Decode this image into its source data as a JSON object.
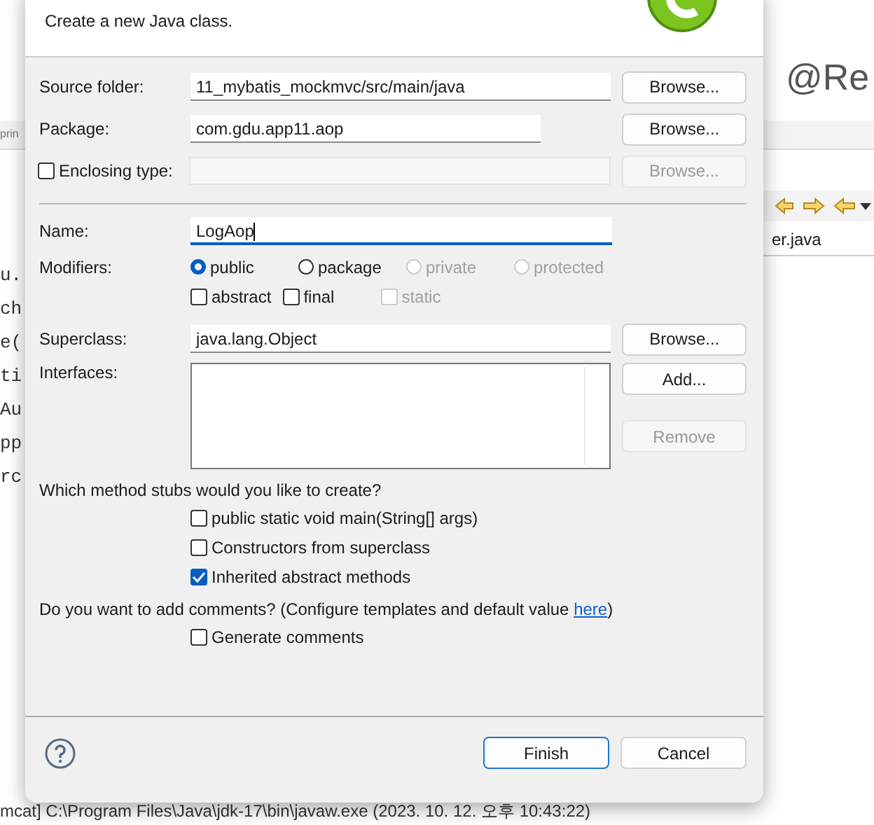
{
  "background": {
    "heading": "@Re",
    "toolbar_text": "prin",
    "editor_tab": "er.java",
    "code_lines": [
      "u.",
      "ch",
      "e(",
      "ti",
      "Au",
      "pp",
      "rc"
    ],
    "console": "mcat] C:\\Program Files\\Java\\jdk-17\\bin\\javaw.exe  (2023. 10. 12. 오후 10:43:22)"
  },
  "dialog": {
    "description": "Create a new Java class.",
    "fields": [
      {
        "kind": "text",
        "label": "Source folder:",
        "value": "11_mybatis_mockmvc/src/main/java",
        "button": "Browse...",
        "button_disabled": false
      },
      {
        "kind": "short",
        "label": "Package:",
        "value": "com.gdu.app11.aop",
        "button": "Browse...",
        "button_disabled": false
      },
      {
        "kind": "check",
        "label": "Enclosing type:",
        "checked": false,
        "button": "Browse...",
        "button_disabled": true
      }
    ],
    "name": {
      "label": "Name:",
      "value": "LogAop"
    },
    "modifiers": {
      "label": "Modifiers:",
      "radios": [
        {
          "label": "public",
          "selected": true,
          "disabled": false
        },
        {
          "label": "package",
          "selected": false,
          "disabled": false
        },
        {
          "label": "private",
          "selected": false,
          "disabled": true
        },
        {
          "label": "protected",
          "selected": false,
          "disabled": true
        }
      ],
      "checks": [
        {
          "label": "abstract",
          "checked": false,
          "disabled": false
        },
        {
          "label": "final",
          "checked": false,
          "disabled": false
        },
        {
          "label": "static",
          "checked": false,
          "disabled": true
        }
      ]
    },
    "superclass": {
      "label": "Superclass:",
      "value": "java.lang.Object",
      "button": "Browse..."
    },
    "interfaces": {
      "label": "Interfaces:",
      "buttons": [
        {
          "label": "Add...",
          "disabled": false
        },
        {
          "label": "Remove",
          "disabled": true
        }
      ]
    },
    "stubs": {
      "question": "Which method stubs would you like to create?",
      "options": [
        {
          "label": "public static void main(String[] args)",
          "checked": false
        },
        {
          "label": "Constructors from superclass",
          "checked": false
        },
        {
          "label": "Inherited abstract methods",
          "checked": true
        }
      ]
    },
    "comments": {
      "question": "Do you want to add comments? (Configure templates and default value ",
      "link": "here",
      "closing": ")",
      "option": {
        "label": "Generate comments",
        "checked": false
      }
    },
    "buttons": [
      {
        "label": "Finish",
        "default": true
      },
      {
        "label": "Cancel",
        "default": false
      }
    ]
  }
}
